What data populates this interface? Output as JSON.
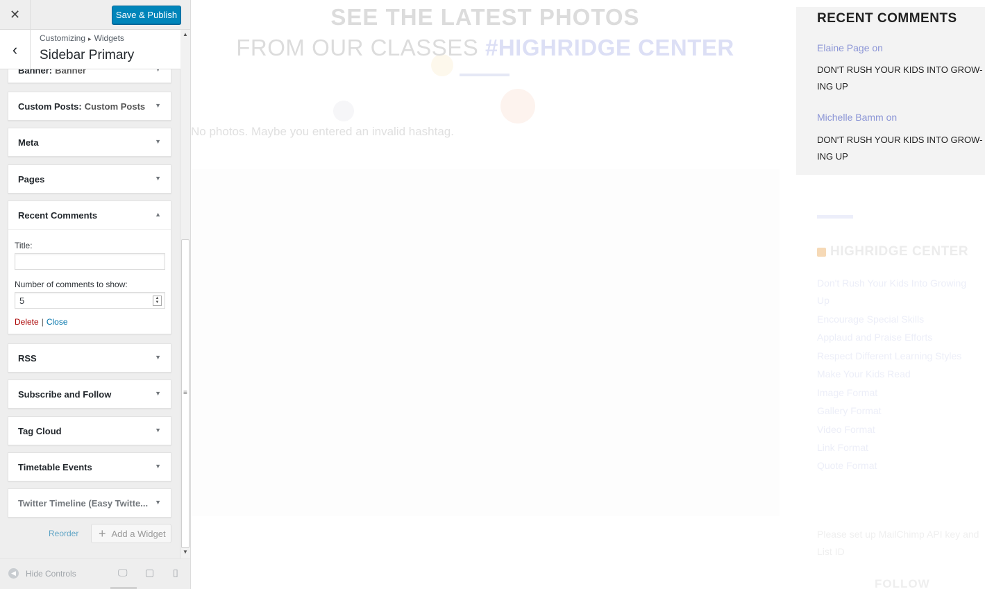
{
  "header": {
    "close_icon": "close-icon",
    "save_label": "Save & Publish"
  },
  "section": {
    "breadcrumb_root": "Customizing",
    "breadcrumb_child": "Widgets",
    "title": "Sidebar Primary"
  },
  "widgets": {
    "banner": {
      "label": "Banner:",
      "sub": "Banner"
    },
    "custom_posts": {
      "label": "Custom Posts:",
      "sub": "Custom Posts"
    },
    "meta": "Meta",
    "pages": "Pages",
    "recent_comments": {
      "label": "Recent Comments",
      "title_label": "Title:",
      "title_value": "",
      "count_label": "Number of comments to show:",
      "count_value": "5",
      "delete": "Delete",
      "separator": "|",
      "close": "Close"
    },
    "rss": "RSS",
    "subscribe": "Subscribe and Follow",
    "tag_cloud": "Tag Cloud",
    "timetable": "Timetable Events",
    "twitter": "Twitter Timeline (Easy Twitte..."
  },
  "actions": {
    "reorder": "Reorder",
    "add_widget": "Add a Widget"
  },
  "footer": {
    "hide_controls": "Hide Controls",
    "devices": [
      "desktop-icon",
      "tablet-icon",
      "mobile-icon"
    ]
  },
  "preview": {
    "photos_heading_1": "SEE THE LATEST PHOTOS",
    "photos_heading_2": "FROM OUR CLASSES",
    "photos_hashtag": "#HIGHRIDGE CENTER",
    "no_photos": "No photos. Maybe you entered an invalid hashtag.",
    "recent_comments_title": "RECENT COMMENTS",
    "comments": [
      {
        "author": "Elaine Page on",
        "post": "DON'T RUSH YOUR KIDS INTO GROW-ING UP"
      },
      {
        "author": "Michelle Bamm on",
        "post": "DON'T RUSH YOUR KIDS INTO GROW-ING UP"
      }
    ],
    "rss_title": "HIGHRIDGE CENTER",
    "rss_items": [
      "Don't Rush Your Kids Into Growing Up",
      "Encourage Special Skills",
      "Applaud and Praise Efforts",
      "Respect Different Learning Styles",
      "Make Your Kids Read",
      "Image Format",
      "Gallery Format",
      "Video Format",
      "Link Format",
      "Quote Format"
    ],
    "mailchimp_notice": "Please set up MailChimp API key and List ID",
    "follow_title": "FOLLOW"
  },
  "colors": {
    "primary_button": "#0085ba",
    "link": "#0073aa",
    "delete": "#aa0000",
    "accent": "#8b95d6"
  }
}
